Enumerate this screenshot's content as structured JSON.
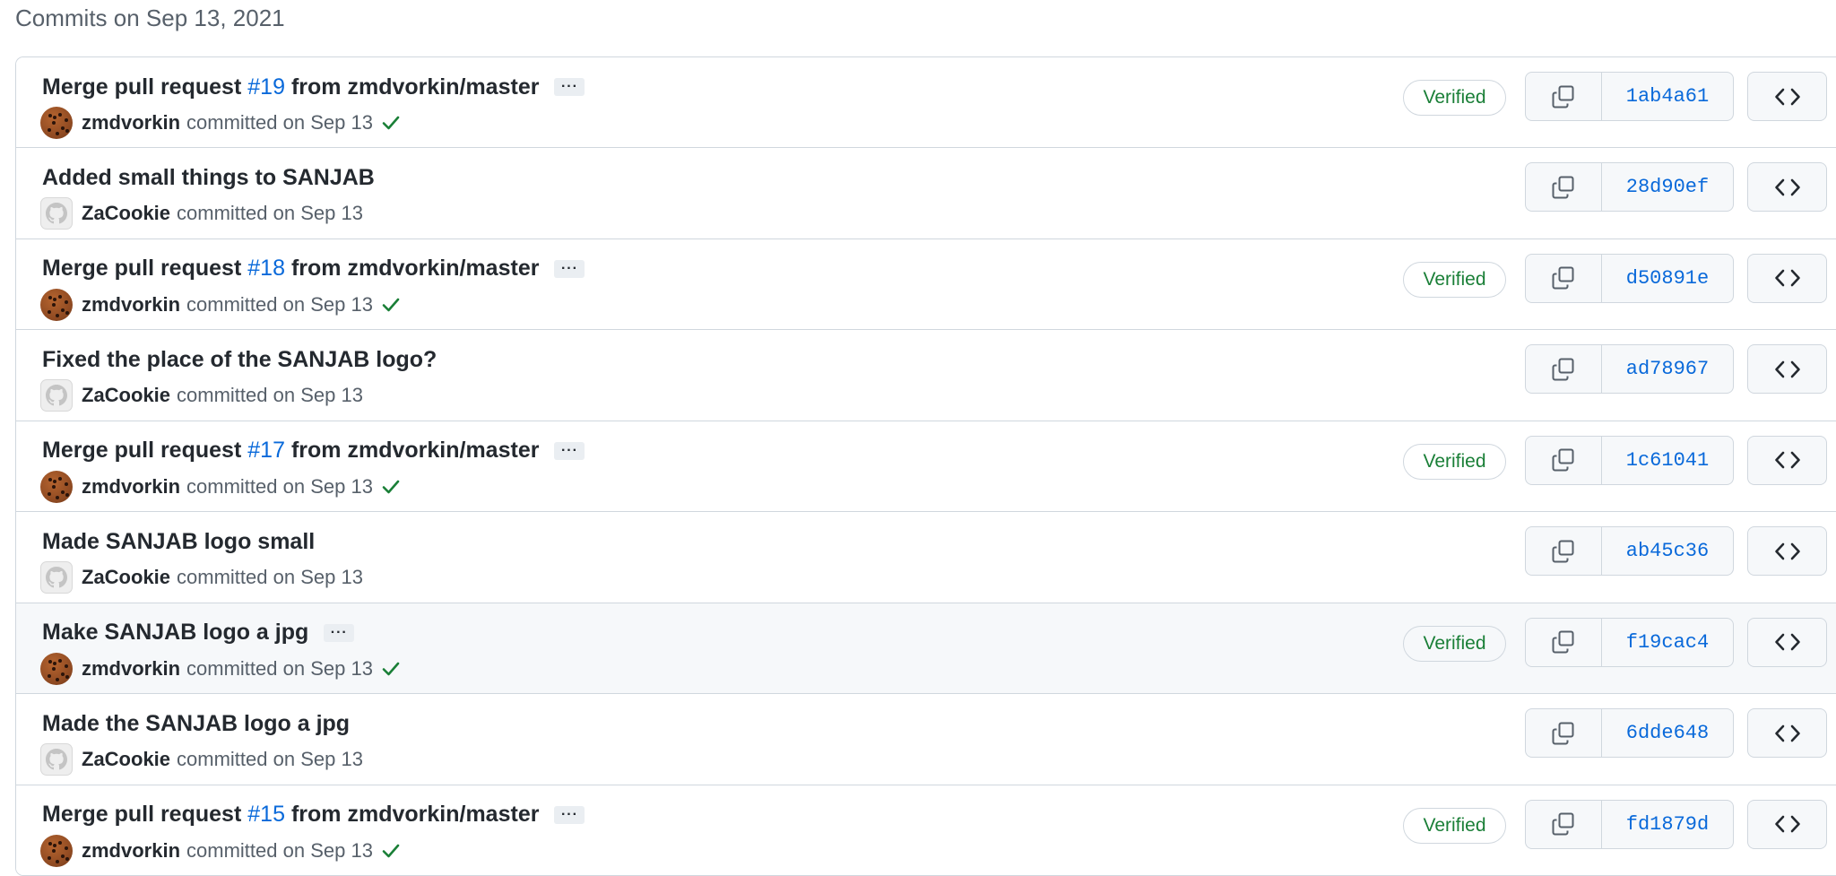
{
  "group_title": "Commits on Sep 13, 2021",
  "colors": {
    "link": "#0969da",
    "verified": "#1a7f37",
    "border": "#d0d7de",
    "muted": "#57606a"
  },
  "commits": [
    {
      "title_pre": "Merge pull request",
      "pr": "#19",
      "title_post": "from zmdvorkin/master",
      "has_ellipsis": true,
      "ellipsis": "···",
      "author": "zmdvorkin",
      "avatar": "cookie-avatar",
      "meta": "committed on Sep 13",
      "checked": true,
      "verified": "Verified",
      "sha": "1ab4a61",
      "hover": false
    },
    {
      "title_pre": "Added small things to SANJAB",
      "pr": "",
      "title_post": "",
      "has_ellipsis": false,
      "ellipsis": "",
      "author": "ZaCookie",
      "avatar": "default-avatar",
      "meta": "committed on Sep 13",
      "checked": false,
      "verified": "",
      "sha": "28d90ef",
      "hover": false
    },
    {
      "title_pre": "Merge pull request",
      "pr": "#18",
      "title_post": "from zmdvorkin/master",
      "has_ellipsis": true,
      "ellipsis": "···",
      "author": "zmdvorkin",
      "avatar": "cookie-avatar",
      "meta": "committed on Sep 13",
      "checked": true,
      "verified": "Verified",
      "sha": "d50891e",
      "hover": false
    },
    {
      "title_pre": "Fixed the place of the SANJAB logo?",
      "pr": "",
      "title_post": "",
      "has_ellipsis": false,
      "ellipsis": "",
      "author": "ZaCookie",
      "avatar": "default-avatar",
      "meta": "committed on Sep 13",
      "checked": false,
      "verified": "",
      "sha": "ad78967",
      "hover": false
    },
    {
      "title_pre": "Merge pull request",
      "pr": "#17",
      "title_post": "from zmdvorkin/master",
      "has_ellipsis": true,
      "ellipsis": "···",
      "author": "zmdvorkin",
      "avatar": "cookie-avatar",
      "meta": "committed on Sep 13",
      "checked": true,
      "verified": "Verified",
      "sha": "1c61041",
      "hover": false
    },
    {
      "title_pre": "Made SANJAB logo small",
      "pr": "",
      "title_post": "",
      "has_ellipsis": false,
      "ellipsis": "",
      "author": "ZaCookie",
      "avatar": "default-avatar",
      "meta": "committed on Sep 13",
      "checked": false,
      "verified": "",
      "sha": "ab45c36",
      "hover": false
    },
    {
      "title_pre": "Make SANJAB logo a jpg",
      "pr": "",
      "title_post": "",
      "has_ellipsis": true,
      "ellipsis": "···",
      "author": "zmdvorkin",
      "avatar": "cookie-avatar",
      "meta": "committed on Sep 13",
      "checked": true,
      "verified": "Verified",
      "sha": "f19cac4",
      "hover": true
    },
    {
      "title_pre": "Made the SANJAB logo a jpg",
      "pr": "",
      "title_post": "",
      "has_ellipsis": false,
      "ellipsis": "",
      "author": "ZaCookie",
      "avatar": "default-avatar",
      "meta": "committed on Sep 13",
      "checked": false,
      "verified": "",
      "sha": "6dde648",
      "hover": false
    },
    {
      "title_pre": "Merge pull request",
      "pr": "#15",
      "title_post": "from zmdvorkin/master",
      "has_ellipsis": true,
      "ellipsis": "···",
      "author": "zmdvorkin",
      "avatar": "cookie-avatar",
      "meta": "committed on Sep 13",
      "checked": true,
      "verified": "Verified",
      "sha": "fd1879d",
      "hover": false
    }
  ],
  "icons": {
    "copy": "copy-icon",
    "browse": "code-icon",
    "check": "check-icon"
  }
}
